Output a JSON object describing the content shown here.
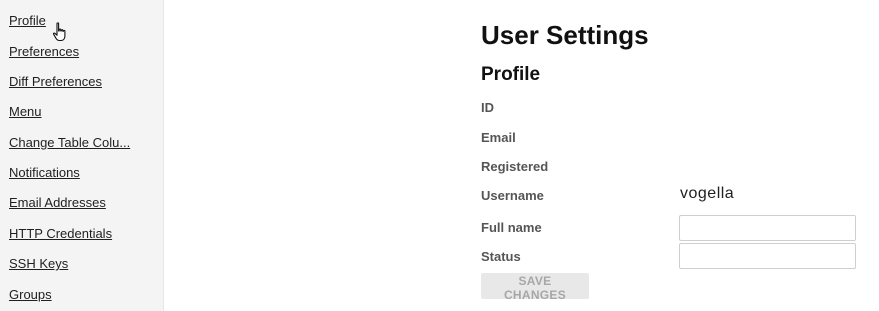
{
  "sidebar": {
    "items": [
      {
        "label": "Profile"
      },
      {
        "label": "Preferences"
      },
      {
        "label": "Diff Preferences"
      },
      {
        "label": "Menu"
      },
      {
        "label": "Change Table Colu..."
      },
      {
        "label": "Notifications"
      },
      {
        "label": "Email Addresses"
      },
      {
        "label": "HTTP Credentials"
      },
      {
        "label": "SSH Keys"
      },
      {
        "label": "Groups"
      }
    ]
  },
  "main": {
    "title": "User Settings",
    "section_title": "Profile",
    "fields": {
      "id_label": "ID",
      "email_label": "Email",
      "registered_label": "Registered",
      "username_label": "Username",
      "username_value": "vogella",
      "full_name_label": "Full name",
      "full_name_value": "",
      "status_label": "Status",
      "status_value": ""
    },
    "save_button_label": "SAVE CHANGES"
  },
  "colors": {
    "sidebar_bg": "#f4f4f4",
    "button_bg": "#e8e8e8",
    "button_text_disabled": "#a7a7a7"
  },
  "icons": {
    "cursor": "hand-pointer-icon"
  }
}
